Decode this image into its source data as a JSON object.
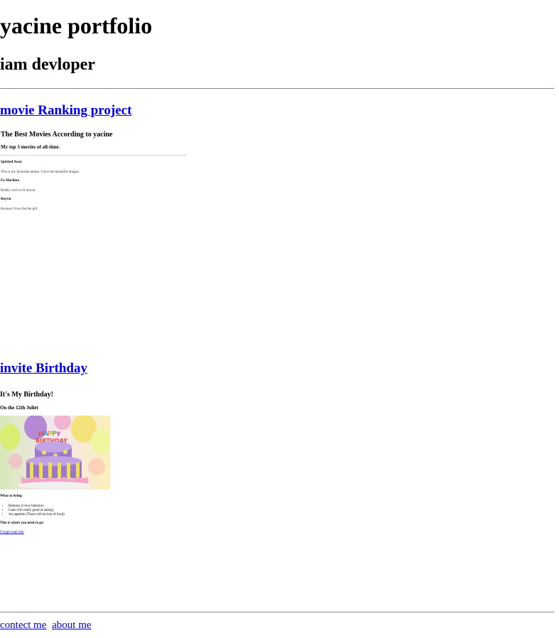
{
  "header": {
    "title": "yacine portfolio",
    "subtitle": "iam devloper"
  },
  "projects": {
    "movie": {
      "link_label": "movie Ranking project",
      "preview": {
        "title": "The Best Movies According to yacine",
        "subtitle": "My top 3 movies of all-time.",
        "items": [
          {
            "name": "Spirited Away",
            "desc": "This is my favourite anime. I love the beautiful images."
          },
          {
            "name": "Ex Machina",
            "desc": "Really cool sci-fi movie."
          },
          {
            "name": "Boyrac",
            "desc": "because I love the the girl"
          }
        ]
      }
    },
    "birthday": {
      "link_label": "invite Birthday",
      "preview": {
        "title": "It's My Birthday!",
        "date": "On the 12th Juliet",
        "image_alt": "birthday cake",
        "bring_heading": "What to bring:",
        "bring_items": [
          "Baloons (I love baloons)",
          "Cake (I'm really good at eating)",
          "An appetite (There will be lots of food)"
        ],
        "where_heading": "This is where you need to go:",
        "map_link": "Google map link"
      }
    }
  },
  "footer": {
    "contact_label": "contect me",
    "about_label": "about me"
  }
}
